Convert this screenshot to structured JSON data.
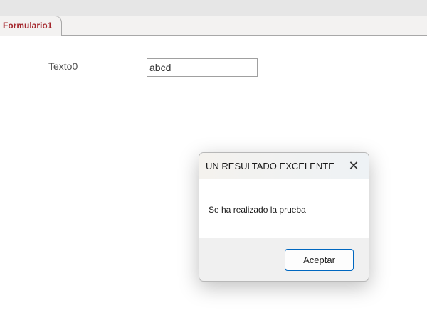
{
  "tab": {
    "label": "Formulario1"
  },
  "form": {
    "label": "Texto0",
    "value": "abcd"
  },
  "dialog": {
    "title": "UN RESULTADO EXCELENTE",
    "close": "✕",
    "message": "Se ha realizado la prueba",
    "ok": "Aceptar"
  }
}
